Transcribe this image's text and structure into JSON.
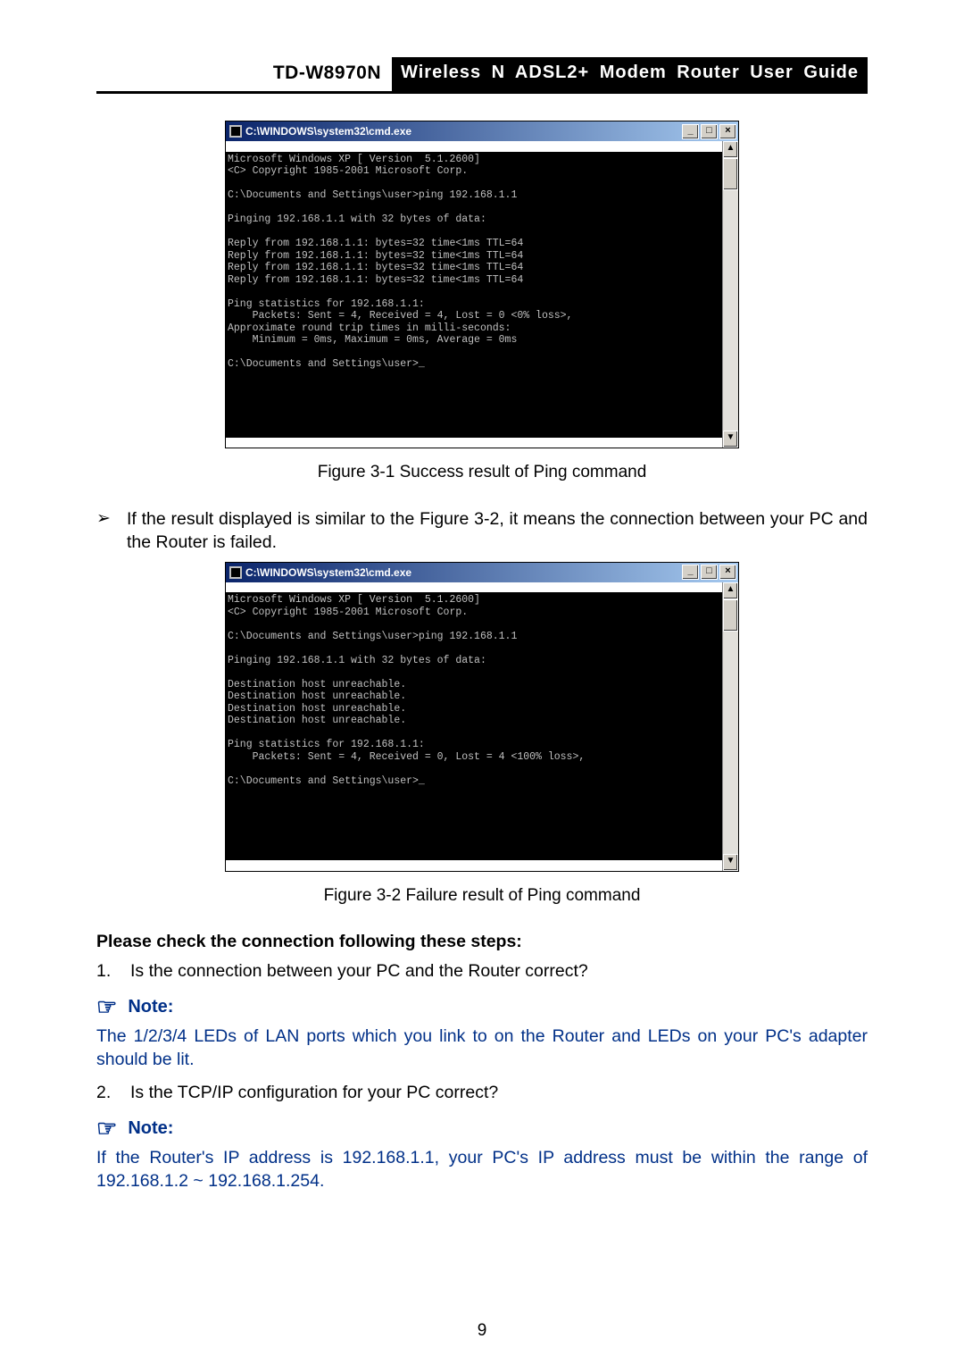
{
  "header": {
    "model": "TD-W8970N",
    "guide": "Wireless N ADSL2+ Modem Router User Guide"
  },
  "console1": {
    "title": "C:\\WINDOWS\\system32\\cmd.exe",
    "lines": [
      "Microsoft Windows XP [ Version  5.1.2600]",
      "<C> Copyright 1985-2001 Microsoft Corp.",
      "",
      "C:\\Documents and Settings\\user>ping 192.168.1.1",
      "",
      "Pinging 192.168.1.1 with 32 bytes of data:",
      "",
      "Reply from 192.168.1.1: bytes=32 time<1ms TTL=64",
      "Reply from 192.168.1.1: bytes=32 time<1ms TTL=64",
      "Reply from 192.168.1.1: bytes=32 time<1ms TTL=64",
      "Reply from 192.168.1.1: bytes=32 time<1ms TTL=64",
      "",
      "Ping statistics for 192.168.1.1:",
      "    Packets: Sent = 4, Received = 4, Lost = 0 <0% loss>,",
      "Approximate round trip times in milli-seconds:",
      "    Minimum = 0ms, Maximum = 0ms, Average = 0ms",
      "",
      "C:\\Documents and Settings\\user>_"
    ]
  },
  "caption1": "Figure 3-1    Success result of Ping command",
  "bullet1": "If the result displayed is similar to the Figure 3-2, it means the connection between your PC and the Router is failed.",
  "console2": {
    "title": "C:\\WINDOWS\\system32\\cmd.exe",
    "lines": [
      "Microsoft Windows XP [ Version  5.1.2600]",
      "<C> Copyright 1985-2001 Microsoft Corp.",
      "",
      "C:\\Documents and Settings\\user>ping 192.168.1.1",
      "",
      "Pinging 192.168.1.1 with 32 bytes of data:",
      "",
      "Destination host unreachable.",
      "Destination host unreachable.",
      "Destination host unreachable.",
      "Destination host unreachable.",
      "",
      "Ping statistics for 192.168.1.1:",
      "    Packets: Sent = 4, Received = 0, Lost = 4 <100% loss>,",
      "",
      "C:\\Documents and Settings\\user>_"
    ]
  },
  "caption2": "Figure 3-2    Failure result of Ping command",
  "check_heading": "Please check the connection following these steps:",
  "step1_num": "1.",
  "step1": "Is the connection between your PC and the Router correct?",
  "note_label": "Note:",
  "note1": "The 1/2/3/4 LEDs of LAN ports which you link to on the Router and LEDs on your PC's adapter should be lit.",
  "step2_num": "2.",
  "step2": "Is the TCP/IP configuration for your PC correct?",
  "note2": "If the Router's IP address is 192.168.1.1, your PC's IP address must be within the range of 192.168.1.2 ~ 192.168.1.254.",
  "page_number": "9",
  "glyphs": {
    "arrow": "➢",
    "hand": "☞",
    "min": "_",
    "max": "□",
    "close": "×",
    "up": "▲",
    "down": "▼"
  }
}
